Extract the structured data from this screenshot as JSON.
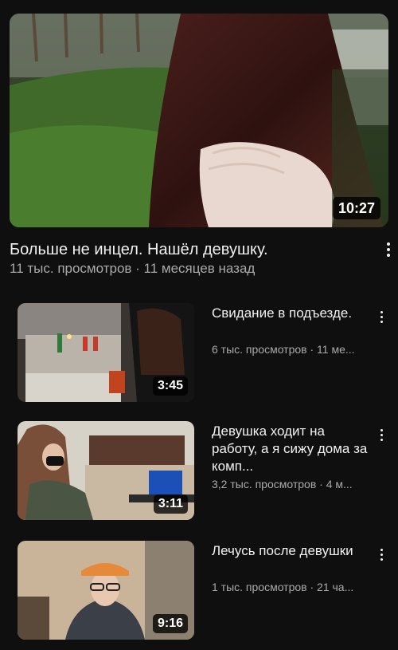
{
  "featured": {
    "title": "Больше не инцел. Нашёл девушку.",
    "meta": "11 тыс. просмотров · 11 месяцев назад",
    "duration": "10:27"
  },
  "videos": [
    {
      "title": "Свидание в подъезде.",
      "meta": "6 тыс. просмотров · 11 ме...",
      "duration": "3:45"
    },
    {
      "title": "Девушка ходит на работу, а я сижу дома за комп...",
      "meta": "3,2 тыс. просмотров · 4 м...",
      "duration": "3:11"
    },
    {
      "title": "Лечусь после девушки",
      "meta": "1 тыс. просмотров · 21 ча...",
      "duration": "9:16"
    }
  ],
  "colors": {
    "background": "#0f0f0f",
    "primary_text": "#f1f1f1",
    "secondary_text": "#aaaaaa"
  },
  "icons": {
    "more": "more-vert-icon"
  }
}
